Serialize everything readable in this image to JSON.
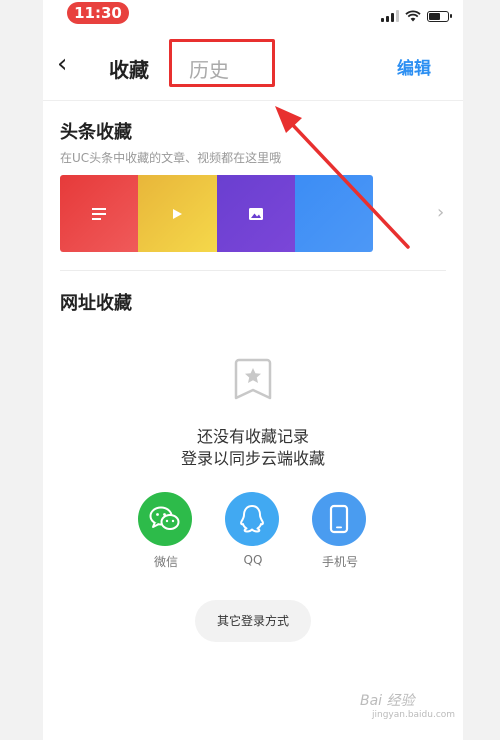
{
  "status_bar": {
    "time": "11:30"
  },
  "header": {
    "back_glyph": "‹",
    "tab_favorites": "收藏",
    "tab_history": "历史",
    "edit_label": "编辑"
  },
  "headlines": {
    "title": "头条收藏",
    "subtitle": "在UC头条中收藏的文章、视频都在这里哦",
    "tiles": [
      {
        "icon": "article-icon",
        "color": "#e63a3a"
      },
      {
        "icon": "play-icon",
        "color": "#f0c842"
      },
      {
        "icon": "image-icon",
        "color": "#6a3fd0"
      },
      {
        "icon": "blank",
        "color": "#3c8df5"
      }
    ],
    "chevron": "›"
  },
  "bookmarks": {
    "title": "网址收藏",
    "empty_line1": "还没有收藏记录",
    "empty_line2": "登录以同步云端收藏"
  },
  "login_options": [
    {
      "label": "微信",
      "icon": "wechat-icon",
      "color": "#2dbb4a"
    },
    {
      "label": "QQ",
      "icon": "qq-icon",
      "color": "#41a9f2"
    },
    {
      "label": "手机号",
      "icon": "phone-icon",
      "color": "#4a9cf0"
    }
  ],
  "other_login_label": "其它登录方式",
  "watermark": {
    "main": "Bai 经验",
    "sub": "jingyan.baidu.com"
  },
  "colors": {
    "accent": "#2c8ff2",
    "annotation": "#e8302f"
  }
}
